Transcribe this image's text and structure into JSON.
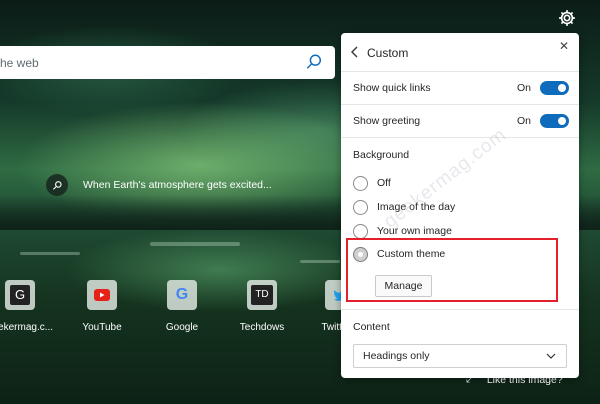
{
  "search": {
    "placeholder_visible": "he web"
  },
  "caption": {
    "text": "When Earth's atmosphere gets excited..."
  },
  "quick_links": [
    {
      "letter": "G",
      "label": "geekermag.c...",
      "icon": "g-letter-icon"
    },
    {
      "letter": "",
      "label": "YouTube",
      "icon": "youtube-icon"
    },
    {
      "letter": "G",
      "label": "Google",
      "icon": "google-icon"
    },
    {
      "letter": "TD",
      "label": "Techdows",
      "icon": "td-letter-icon"
    },
    {
      "letter": "",
      "label": "Twitter...",
      "icon": "twitter-icon"
    }
  ],
  "like": {
    "text": "Like this image?"
  },
  "panel": {
    "title": "Custom",
    "quick_links": {
      "label": "Show quick links",
      "state": "On"
    },
    "greeting": {
      "label": "Show greeting",
      "state": "On"
    },
    "background": {
      "heading": "Background",
      "options": [
        {
          "label": "Off",
          "checked": false
        },
        {
          "label": "Image of the day",
          "checked": false
        },
        {
          "label": "Your own image",
          "checked": false
        },
        {
          "label": "Custom theme",
          "checked": true
        }
      ],
      "manage_label": "Manage"
    },
    "content": {
      "heading": "Content",
      "selected": "Headings only"
    }
  },
  "watermark": {
    "text": "geekermag.com"
  },
  "colors": {
    "accent": "#0f6cbd",
    "highlight": "#e3202c"
  }
}
